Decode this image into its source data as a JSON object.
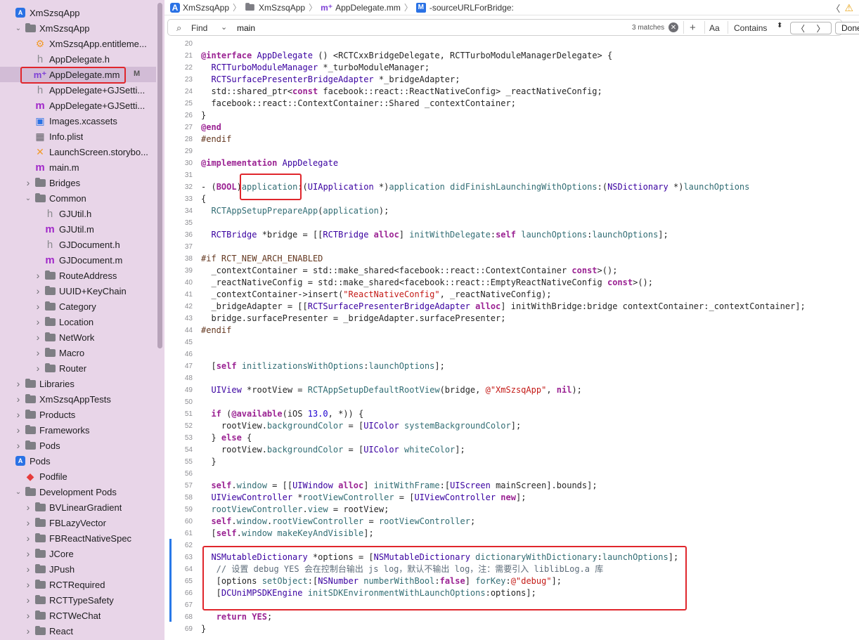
{
  "sidebar": {
    "items": [
      {
        "label": "XmSzsqApp",
        "icon": "project-icon",
        "disc": ""
      },
      {
        "label": "XmSzsqApp",
        "icon": "folder-icon",
        "disc": "open"
      },
      {
        "label": "XmSzsqApp.entitleme...",
        "icon": "entitlements-icon",
        "disc": ""
      },
      {
        "label": "AppDelegate.h",
        "icon": "header-file-icon",
        "disc": ""
      },
      {
        "label": "AppDelegate.mm",
        "icon": "objcpp-file-icon",
        "disc": "",
        "badge": "M"
      },
      {
        "label": "AppDelegate+GJSetti...",
        "icon": "header-file-icon",
        "disc": ""
      },
      {
        "label": "AppDelegate+GJSetti...",
        "icon": "objc-file-icon",
        "disc": ""
      },
      {
        "label": "Images.xcassets",
        "icon": "assets-icon",
        "disc": ""
      },
      {
        "label": "Info.plist",
        "icon": "plist-icon",
        "disc": ""
      },
      {
        "label": "LaunchScreen.storybo...",
        "icon": "storyboard-icon",
        "disc": ""
      },
      {
        "label": "main.m",
        "icon": "objc-file-icon",
        "disc": ""
      },
      {
        "label": "Bridges",
        "icon": "folder-icon",
        "disc": "closed"
      },
      {
        "label": "Common",
        "icon": "folder-icon",
        "disc": "open"
      },
      {
        "label": "GJUtil.h",
        "icon": "header-file-icon",
        "disc": ""
      },
      {
        "label": "GJUtil.m",
        "icon": "objc-file-icon",
        "disc": ""
      },
      {
        "label": "GJDocument.h",
        "icon": "header-file-icon",
        "disc": ""
      },
      {
        "label": "GJDocument.m",
        "icon": "objc-file-icon",
        "disc": ""
      },
      {
        "label": "RouteAddress",
        "icon": "folder-icon",
        "disc": "closed"
      },
      {
        "label": "UUID+KeyChain",
        "icon": "folder-icon",
        "disc": "closed"
      },
      {
        "label": "Category",
        "icon": "folder-icon",
        "disc": "closed"
      },
      {
        "label": "Location",
        "icon": "folder-icon",
        "disc": "closed"
      },
      {
        "label": "NetWork",
        "icon": "folder-icon",
        "disc": "closed"
      },
      {
        "label": "Macro",
        "icon": "folder-icon",
        "disc": "closed"
      },
      {
        "label": "Router",
        "icon": "folder-icon",
        "disc": "closed"
      },
      {
        "label": "Libraries",
        "icon": "folder-icon",
        "disc": "closed"
      },
      {
        "label": "XmSzsqAppTests",
        "icon": "folder-icon",
        "disc": "closed"
      },
      {
        "label": "Products",
        "icon": "folder-icon",
        "disc": "closed"
      },
      {
        "label": "Frameworks",
        "icon": "folder-icon",
        "disc": "closed"
      },
      {
        "label": "Pods",
        "icon": "folder-icon",
        "disc": "closed"
      },
      {
        "label": "Pods",
        "icon": "project-icon",
        "disc": ""
      },
      {
        "label": "Podfile",
        "icon": "ruby-icon",
        "disc": ""
      },
      {
        "label": "Development Pods",
        "icon": "folder-icon",
        "disc": "open"
      },
      {
        "label": "BVLinearGradient",
        "icon": "folder-icon",
        "disc": "closed"
      },
      {
        "label": "FBLazyVector",
        "icon": "folder-icon",
        "disc": "closed"
      },
      {
        "label": "FBReactNativeSpec",
        "icon": "folder-icon",
        "disc": "closed"
      },
      {
        "label": "JCore",
        "icon": "folder-icon",
        "disc": "closed"
      },
      {
        "label": "JPush",
        "icon": "folder-icon",
        "disc": "closed"
      },
      {
        "label": "RCTRequired",
        "icon": "folder-icon",
        "disc": "closed"
      },
      {
        "label": "RCTTypeSafety",
        "icon": "folder-icon",
        "disc": "closed"
      },
      {
        "label": "RCTWeChat",
        "icon": "folder-icon",
        "disc": "closed"
      },
      {
        "label": "React",
        "icon": "folder-icon",
        "disc": "closed"
      }
    ]
  },
  "jumpbar": {
    "crumbs": [
      "XmSzsqApp",
      "XmSzsqApp",
      "AppDelegate.mm",
      "-sourceURLForBridge:"
    ]
  },
  "findbar": {
    "mode": "Find",
    "query": "main",
    "matches": "3 matches",
    "case_label": "Aa",
    "match_mode": "Contains",
    "done_label": "Done"
  },
  "code": {
    "line_numbers": [
      "20",
      "21",
      "22",
      "23",
      "24",
      "25",
      "26",
      "27",
      "28",
      "29",
      "30",
      "31",
      "32",
      "33",
      "34",
      "35",
      "36",
      "37",
      "38",
      "39",
      "40",
      "41",
      "42",
      "43",
      "44",
      "45",
      "46",
      "47",
      "48",
      "49",
      "50",
      "51",
      "52",
      "53",
      "54",
      "55",
      "56",
      "57",
      "58",
      "59",
      "60",
      "61",
      "62",
      "63",
      "64",
      "65",
      "66",
      "67",
      "68",
      "69"
    ],
    "lines": [
      "",
      "@interface AppDelegate () <RCTCxxBridgeDelegate, RCTTurboModuleManagerDelegate> {",
      "  RCTTurboModuleManager *_turboModuleManager;",
      "  RCTSurfacePresenterBridgeAdapter *_bridgeAdapter;",
      "  std::shared_ptr<const facebook::react::ReactNativeConfig> _reactNativeConfig;",
      "  facebook::react::ContextContainer::Shared _contextContainer;",
      "}",
      "@end",
      "#endif",
      "",
      "@implementation AppDelegate",
      "",
      "- (BOOL)application:(UIApplication *)application didFinishLaunchingWithOptions:(NSDictionary *)launchOptions",
      "{",
      "  RCTAppSetupPrepareApp(application);",
      "",
      "  RCTBridge *bridge = [[RCTBridge alloc] initWithDelegate:self launchOptions:launchOptions];",
      "",
      "#if RCT_NEW_ARCH_ENABLED",
      "  _contextContainer = std::make_shared<facebook::react::ContextContainer const>();",
      "  _reactNativeConfig = std::make_shared<facebook::react::EmptyReactNativeConfig const>();",
      "  _contextContainer->insert(\"ReactNativeConfig\", _reactNativeConfig);",
      "  _bridgeAdapter = [[RCTSurfacePresenterBridgeAdapter alloc] initWithBridge:bridge contextContainer:_contextContainer];",
      "  bridge.surfacePresenter = _bridgeAdapter.surfacePresenter;",
      "#endif",
      "",
      "",
      "  [self initlizationsWithOptions:launchOptions];",
      "",
      "  UIView *rootView = RCTAppSetupDefaultRootView(bridge, @\"XmSzsqApp\", nil);",
      "",
      "  if (@available(iOS 13.0, *)) {",
      "    rootView.backgroundColor = [UIColor systemBackgroundColor];",
      "  } else {",
      "    rootView.backgroundColor = [UIColor whiteColor];",
      "  }",
      "",
      "  self.window = [[UIWindow alloc] initWithFrame:[UIScreen mainScreen].bounds];",
      "  UIViewController *rootViewController = [UIViewController new];",
      "  rootViewController.view = rootView;",
      "  self.window.rootViewController = rootViewController;",
      "  [self.window makeKeyAndVisible];",
      "",
      "  NSMutableDictionary *options = [NSMutableDictionary dictionaryWithDictionary:launchOptions];",
      "   // 设置 debug YES 会在控制台输出 js log，默认不输出 log，注：需要引入 liblibLog.a 库",
      "   [options setObject:[NSNumber numberWithBool:false] forKey:@\"debug\"];",
      "   [DCUniMPSDKEngine initSDKEnvironmentWithLaunchOptions:options];",
      "",
      "   return YES;",
      "}"
    ]
  },
  "colors": {
    "sidebar_bg": "#e8d5e8",
    "selection": "#d2bcd6",
    "annotation_red": "#e0262c",
    "keyword": "#9b2393",
    "type": "#3900a0",
    "method": "#326d74",
    "string": "#c41a16",
    "number": "#1c00cf",
    "comment": "#5d6c79",
    "change_bar": "#2878e8"
  }
}
